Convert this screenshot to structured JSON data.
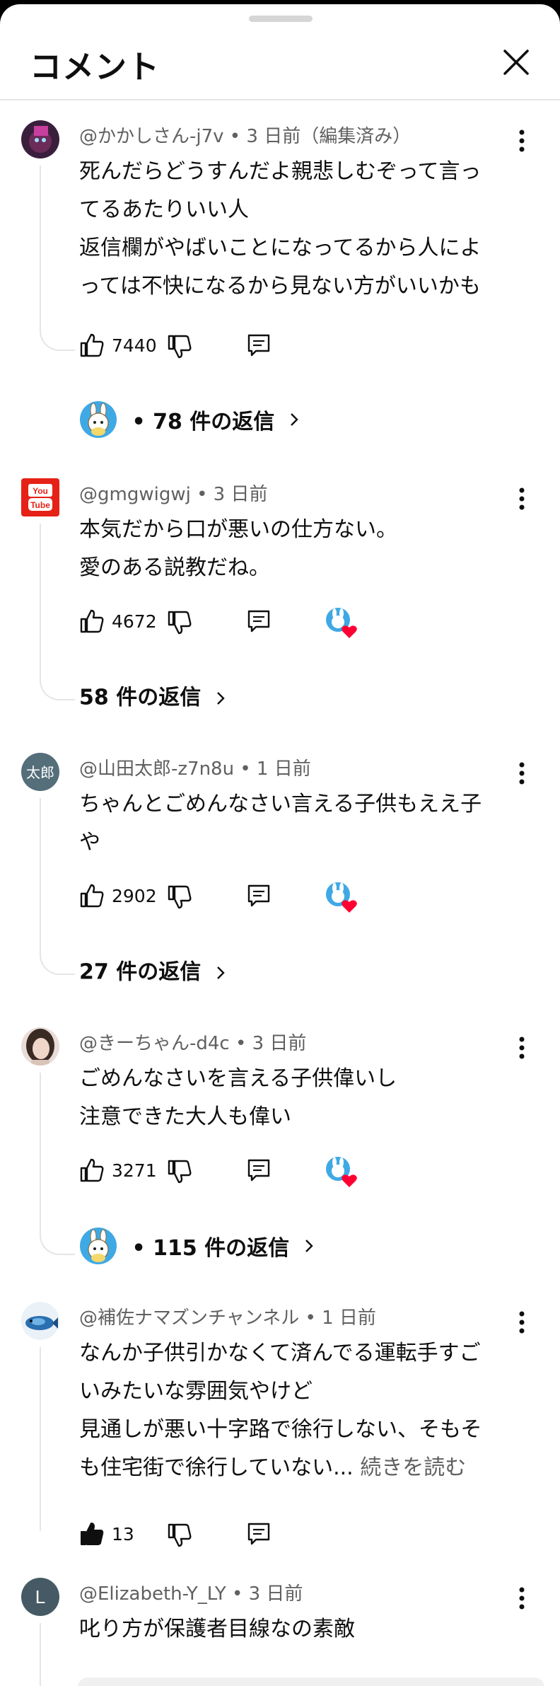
{
  "header": {
    "title": "コメント"
  },
  "comments": [
    {
      "meta": "@かかしさん-j7v • 3 日前（編集済み）",
      "lines": [
        "死んだらどうすんだよ親悲しむぞって言っ",
        "てるあたりいい人",
        "返信欄がやばいことになってるから人によ",
        "っては不快になるから見ない方がいいかも"
      ],
      "likes": "7440",
      "replies": "• 78 件の返信"
    },
    {
      "meta": "@gmgwigwj • 3 日前",
      "lines": [
        "本気だから口が悪いの仕方ない。",
        "愛のある説教だね。"
      ],
      "likes": "4672",
      "replies": "58 件の返信"
    },
    {
      "meta": "@山田太郎-z7n8u • 1 日前",
      "avatar_text": "太郎",
      "lines": [
        "ちゃんとごめんなさい言える子供もええ子",
        "や"
      ],
      "likes": "2902",
      "replies": "27 件の返信"
    },
    {
      "meta": "@きーちゃん-d4c • 3 日前",
      "lines": [
        "ごめんなさいを言える子供偉いし",
        "注意できた大人も偉い"
      ],
      "likes": "3271",
      "replies": "• 115 件の返信"
    },
    {
      "meta": "@補佐ナマズンチャンネル • 1 日前",
      "lines": [
        "なんか子供引かなくて済んでる運転手すご",
        "いみたいな雰囲気やけど",
        "見通しが悪い十字路で徐行しない、そもそ",
        "も住宅街で徐行していない..."
      ],
      "read_more": " 続きを読む",
      "likes": "13"
    },
    {
      "meta": "@Elizabeth-Y_LY • 3 日前",
      "avatar_text": "L",
      "lines": [
        "叱り方が保護者目線なの素敵"
      ]
    }
  ],
  "icons": {
    "close": "close-icon",
    "menu": "more-vert-icon",
    "like": "thumb-up-icon",
    "dislike": "thumb-down-icon",
    "reply": "reply-icon",
    "creator_heart": "creator-heart-icon",
    "chevron": "chevron-right-icon"
  },
  "colors": {
    "heart": "#ff0033",
    "youtube_red": "#e62117",
    "secondary_text": "#606060"
  }
}
